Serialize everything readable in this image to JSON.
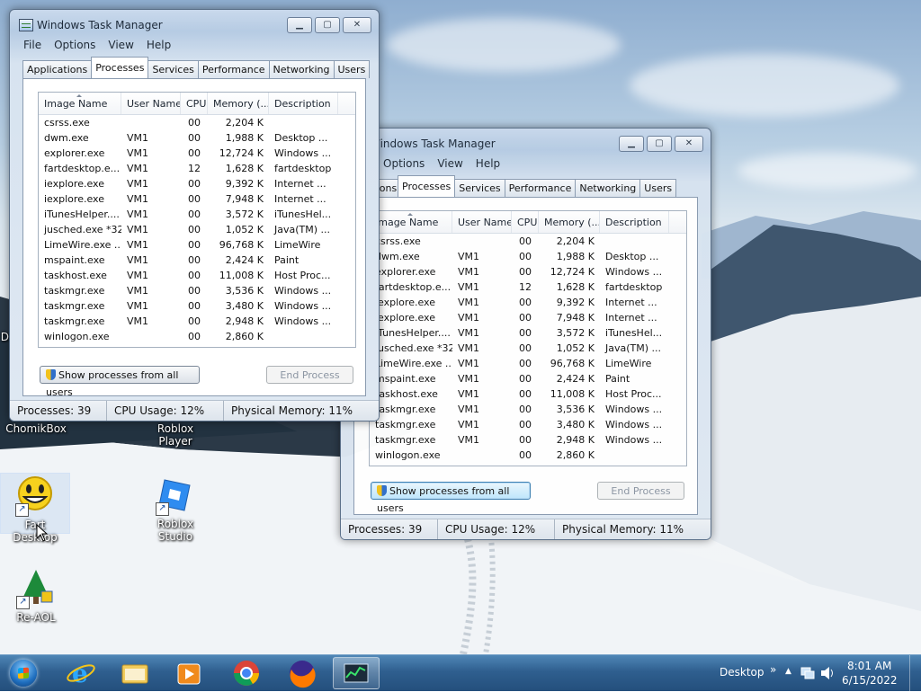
{
  "colors": {
    "taskbar": "#2f5f8f",
    "window_frame": "#b6cbe3",
    "accent": "#3c7fb1"
  },
  "desktop": {
    "icons": [
      {
        "label": "ChomikBox",
        "icon": "folder-icon"
      },
      {
        "label": "Roblox Player",
        "icon": "roblox-icon"
      },
      {
        "label": "Fart Desktop",
        "icon": "smiley-icon"
      },
      {
        "label": "Roblox Studio",
        "icon": "roblox-studio-icon"
      },
      {
        "label": "Re-AOL",
        "icon": "aol-icon"
      },
      {
        "label": "D",
        "icon": "partial-label"
      }
    ]
  },
  "task_manager": {
    "title": "Windows Task Manager",
    "caption_buttons": {
      "minimize": "▁",
      "maximize": "▢",
      "close": "✕"
    },
    "menu": [
      "File",
      "Options",
      "View",
      "Help"
    ],
    "tabs": [
      "Applications",
      "Processes",
      "Services",
      "Performance",
      "Networking",
      "Users"
    ],
    "active_tab": "Processes",
    "columns": [
      "Image Name",
      "User Name",
      "CPU",
      "Memory (...",
      "Description"
    ],
    "rows": [
      {
        "image": "csrss.exe",
        "user": "",
        "cpu": "00",
        "mem": "2,204 K",
        "desc": ""
      },
      {
        "image": "dwm.exe",
        "user": "VM1",
        "cpu": "00",
        "mem": "1,988 K",
        "desc": "Desktop ..."
      },
      {
        "image": "explorer.exe",
        "user": "VM1",
        "cpu": "00",
        "mem": "12,724 K",
        "desc": "Windows ..."
      },
      {
        "image": "fartdesktop.e...",
        "user": "VM1",
        "cpu": "12",
        "mem": "1,628 K",
        "desc": "fartdesktop"
      },
      {
        "image": "iexplore.exe",
        "user": "VM1",
        "cpu": "00",
        "mem": "9,392 K",
        "desc": "Internet ..."
      },
      {
        "image": "iexplore.exe",
        "user": "VM1",
        "cpu": "00",
        "mem": "7,948 K",
        "desc": "Internet ..."
      },
      {
        "image": "iTunesHelper....",
        "user": "VM1",
        "cpu": "00",
        "mem": "3,572 K",
        "desc": "iTunesHel..."
      },
      {
        "image": "jusched.exe *32",
        "user": "VM1",
        "cpu": "00",
        "mem": "1,052 K",
        "desc": "Java(TM) ..."
      },
      {
        "image": "LimeWire.exe ...",
        "user": "VM1",
        "cpu": "00",
        "mem": "96,768 K",
        "desc": "LimeWire"
      },
      {
        "image": "mspaint.exe",
        "user": "VM1",
        "cpu": "00",
        "mem": "2,424 K",
        "desc": "Paint"
      },
      {
        "image": "taskhost.exe",
        "user": "VM1",
        "cpu": "00",
        "mem": "11,008 K",
        "desc": "Host Proc..."
      },
      {
        "image": "taskmgr.exe",
        "user": "VM1",
        "cpu": "00",
        "mem": "3,536 K",
        "desc": "Windows ..."
      },
      {
        "image": "taskmgr.exe",
        "user": "VM1",
        "cpu": "00",
        "mem": "3,480 K",
        "desc": "Windows ..."
      },
      {
        "image": "taskmgr.exe",
        "user": "VM1",
        "cpu": "00",
        "mem": "2,948 K",
        "desc": "Windows ..."
      },
      {
        "image": "winlogon.exe",
        "user": "",
        "cpu": "00",
        "mem": "2,860 K",
        "desc": ""
      }
    ],
    "show_all_button": "Show processes from all users",
    "end_process_button": "End Process",
    "status": {
      "processes": "Processes: 39",
      "cpu": "CPU Usage: 12%",
      "memory": "Physical Memory: 11%"
    }
  },
  "taskbar": {
    "pins": [
      "internet-explorer-icon",
      "windows-explorer-icon",
      "media-player-icon",
      "chrome-icon",
      "firefox-icon",
      "task-manager-icon"
    ],
    "desktop_label": "Desktop",
    "desktop_chevron": "»",
    "tray_arrow": "▲",
    "time": "8:01 AM",
    "date": "6/15/2022"
  }
}
